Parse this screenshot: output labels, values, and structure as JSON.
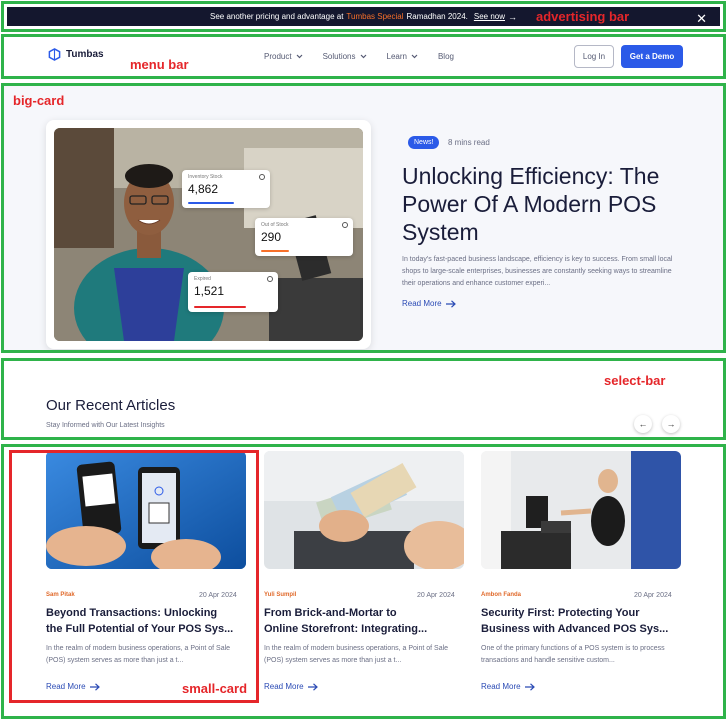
{
  "annotations": {
    "advertising_bar": "advertising bar",
    "menu_bar": "menu bar",
    "big_card": "big-card",
    "select_bar": "select-bar",
    "small_card": "small-card"
  },
  "ad": {
    "text_before": "See another pricing and advantage at",
    "brand": "Tumbas Special",
    "text_after": "Ramadhan 2024.",
    "link": "See now",
    "arrow": "→",
    "close": "✕"
  },
  "menu": {
    "logo": "Tumbas",
    "items": [
      {
        "label": "Product",
        "has_dropdown": true
      },
      {
        "label": "Solutions",
        "has_dropdown": true
      },
      {
        "label": "Learn",
        "has_dropdown": true
      },
      {
        "label": "Blog",
        "has_dropdown": false
      }
    ],
    "login": "Log In",
    "demo": "Get a Demo",
    "chevron": "⌄"
  },
  "hero": {
    "badge": "News!",
    "read_time": "8 mins read",
    "title": "Unlocking Efficiency: The Power Of A Modern POS System",
    "description": "In today's fast-paced business landscape, efficiency is key to success. From small local shops to large-scale enterprises, businesses are constantly seeking ways to streamline their operations and enhance customer experi...",
    "read_more": "Read More",
    "stats": [
      {
        "label": "Inventory Stock",
        "value": "4,862",
        "color": "#2b5ae8",
        "fill": 0.6
      },
      {
        "label": "Out of Stock",
        "value": "290",
        "color": "#f7702a",
        "fill": 0.3
      },
      {
        "label": "Expired",
        "value": "1,521",
        "color": "#e5262a",
        "fill": 0.65
      }
    ]
  },
  "section": {
    "title": "Our Recent Articles",
    "subtitle": "Stay Informed with Our Latest Insights",
    "prev": "←",
    "next": "→"
  },
  "articles": [
    {
      "author": "Sam Pitak",
      "date": "20 Apr 2024",
      "title_line1": "Beyond Transactions: Unlocking",
      "title_line2": "the Full Potential of Your POS Sys...",
      "description": "In the realm of modern business operations, a Point of Sale (POS) system serves as more than just a t...",
      "read_more": "Read More"
    },
    {
      "author": "Yuli Sumpil",
      "date": "20 Apr 2024",
      "title_line1": "From Brick-and-Mortar to",
      "title_line2": "Online Storefront: Integrating...",
      "description": "In the realm of modern business operations, a Point of Sale (POS) system serves as more than just a t...",
      "read_more": "Read More"
    },
    {
      "author": "Ambon Fanda",
      "date": "20 Apr 2024",
      "title_line1": "Security First: Protecting Your",
      "title_line2": "Business with Advanced POS Sys...",
      "description": "One of the primary functions of a POS system is to process transactions and handle sensitive custom...",
      "read_more": "Read More"
    }
  ],
  "colors": {
    "accent": "#2b5ae8",
    "brand_orange": "#f7702a",
    "frame_green": "#2fb34a",
    "annotation_red": "#e5262a"
  }
}
